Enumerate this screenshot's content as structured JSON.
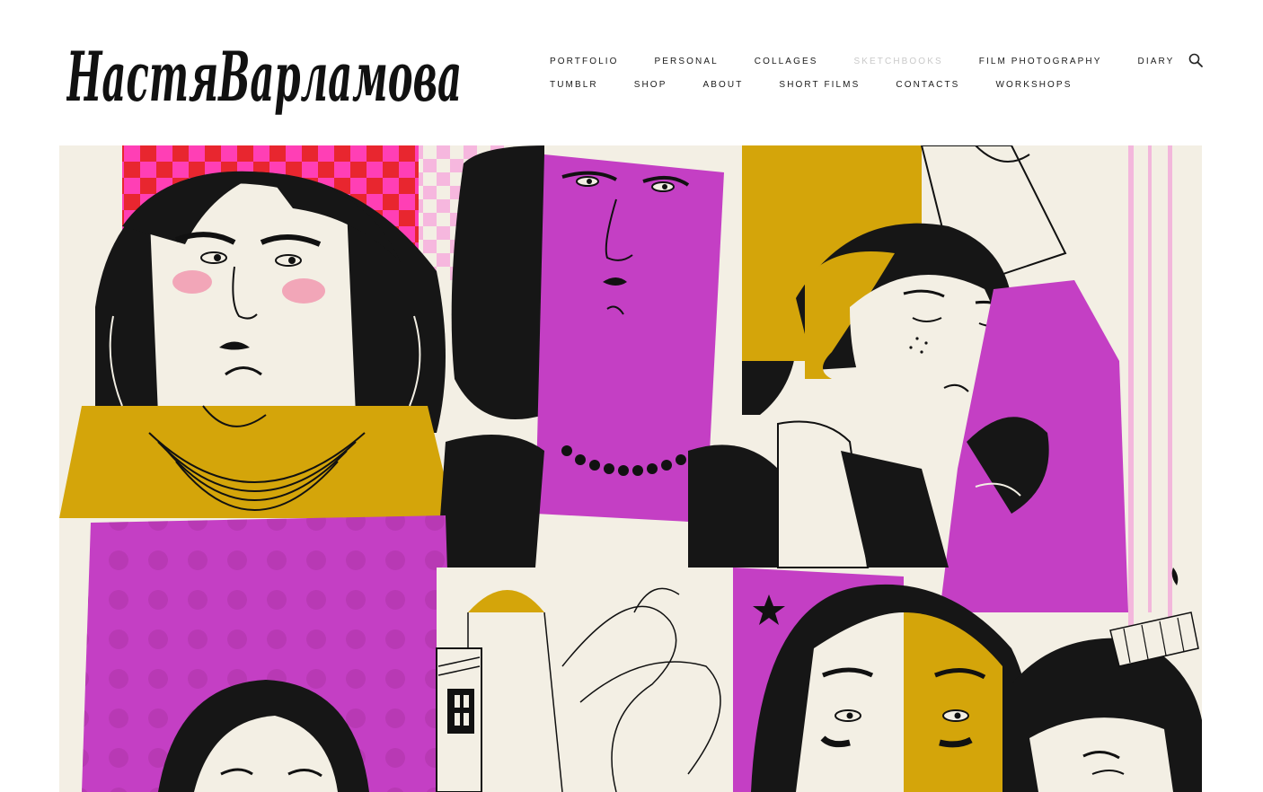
{
  "site": {
    "logo_text": "НастяВарламова"
  },
  "nav": {
    "row1": [
      {
        "label": "PORTFOLIO",
        "active": false
      },
      {
        "label": "PERSONAL",
        "active": false
      },
      {
        "label": "COLLAGES",
        "active": false
      },
      {
        "label": "SKETCHBOOKS",
        "active": true
      },
      {
        "label": "FILM PHOTOGRAPHY",
        "active": false
      },
      {
        "label": "DIARY",
        "active": false
      }
    ],
    "row2": [
      {
        "label": "TUMBLR",
        "active": false
      },
      {
        "label": "SHOP",
        "active": false
      },
      {
        "label": "ABOUT",
        "active": false
      },
      {
        "label": "SHORT FILMS",
        "active": false
      },
      {
        "label": "CONTACTS",
        "active": false
      },
      {
        "label": "WORKSHOPS",
        "active": false
      }
    ],
    "active_color": "#c9c9c9",
    "text_color": "#1a1a1a"
  },
  "search": {
    "icon": "search-icon"
  },
  "hero": {
    "colors": {
      "magenta": "#c43fc4",
      "mustard": "#d4a50a",
      "paper": "#f3efe4",
      "ink": "#111111",
      "pink": "#f0a6d6",
      "red": "#ee2f3a",
      "cheek": "#f2a6b8"
    }
  }
}
